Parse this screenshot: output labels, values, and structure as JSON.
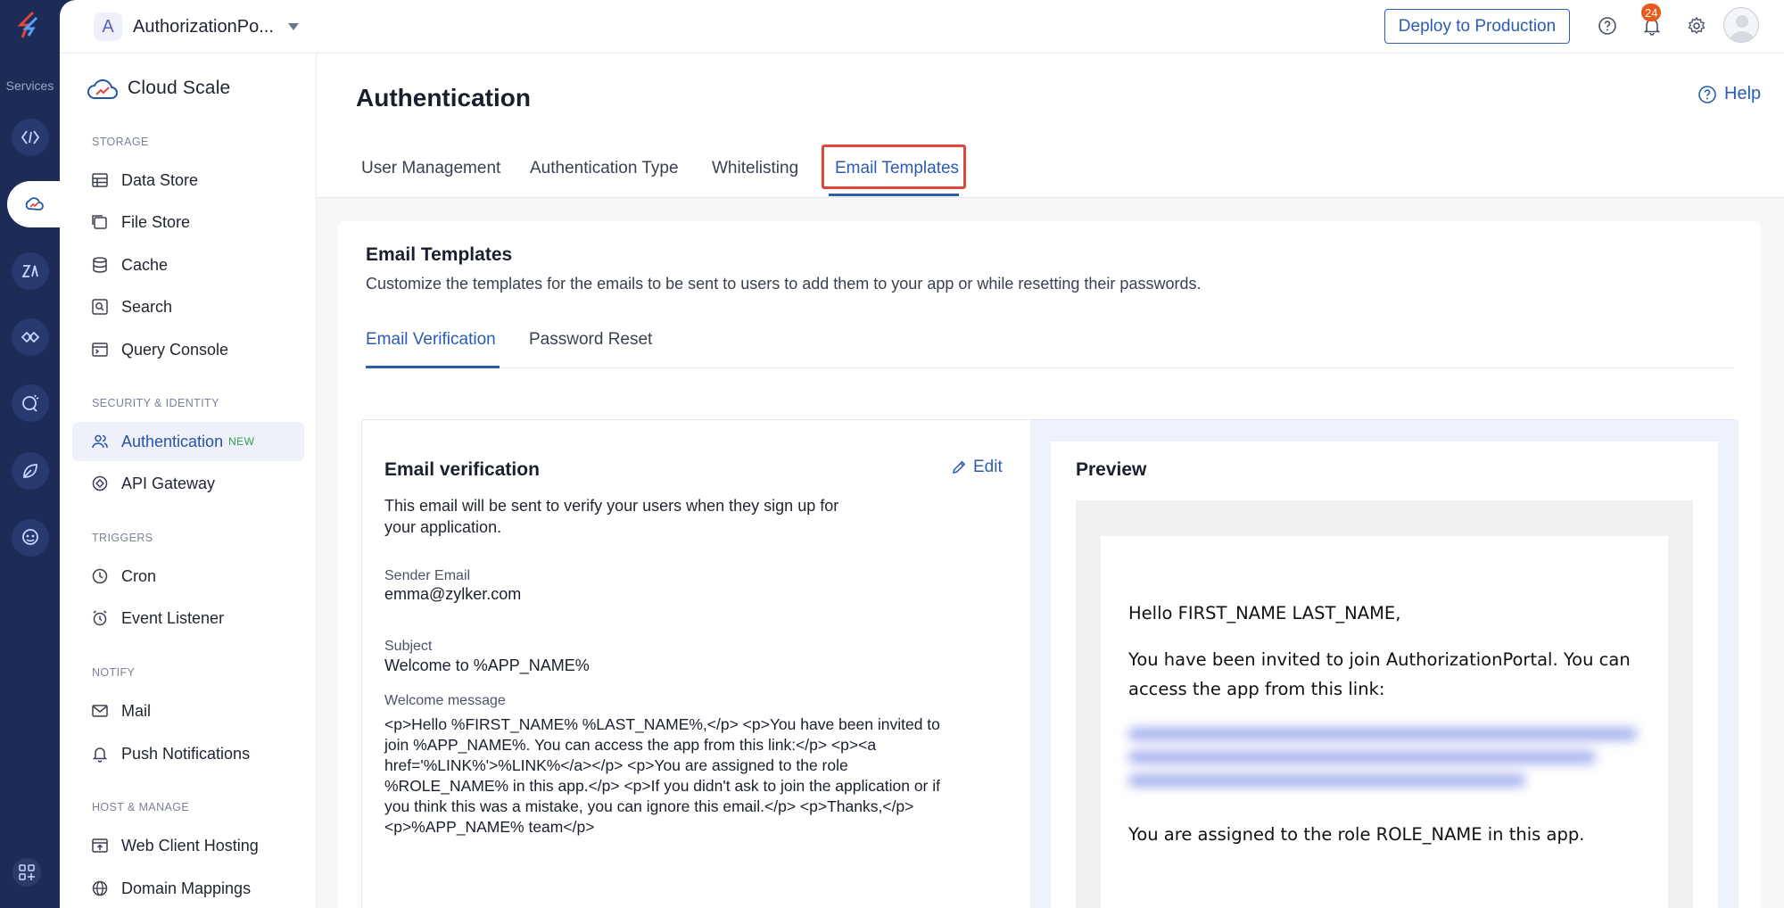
{
  "rail": {
    "services_label": "Services"
  },
  "topbar": {
    "project_initial": "A",
    "project_name": "AuthorizationPo...",
    "deploy_label": "Deploy to Production",
    "notification_count": "24"
  },
  "sidebar": {
    "brand": "Cloud Scale",
    "sections": {
      "storage": "STORAGE",
      "security": "SECURITY & IDENTITY",
      "triggers": "TRIGGERS",
      "notify": "NOTIFY",
      "host": "HOST & MANAGE"
    },
    "items": {
      "data_store": "Data Store",
      "file_store": "File Store",
      "cache": "Cache",
      "search": "Search",
      "query_console": "Query Console",
      "authentication": "Authentication",
      "authentication_badge": "NEW",
      "api_gateway": "API Gateway",
      "cron": "Cron",
      "event_listener": "Event Listener",
      "mail": "Mail",
      "push_notifications": "Push Notifications",
      "web_client_hosting": "Web Client Hosting",
      "domain_mappings": "Domain Mappings"
    }
  },
  "main": {
    "title": "Authentication",
    "help_label": "Help",
    "tabs": {
      "user_management": "User Management",
      "authentication_type": "Authentication Type",
      "whitelisting": "Whitelisting",
      "email_templates": "Email Templates"
    },
    "card": {
      "title": "Email Templates",
      "description": "Customize the templates for the emails to be sent to users to add them to your app or while resetting their passwords.",
      "subtabs": {
        "email_verification": "Email Verification",
        "password_reset": "Password Reset"
      },
      "verification": {
        "title": "Email verification",
        "edit_label": "Edit",
        "description": "This email will be sent to verify your users when they sign up for your application.",
        "sender_label": "Sender Email",
        "sender_value": "emma@zylker.com",
        "subject_label": "Subject",
        "subject_value": "Welcome to %APP_NAME%",
        "message_label": "Welcome message",
        "message_value": "<p>Hello %FIRST_NAME% %LAST_NAME%,</p> <p>You have been invited to join %APP_NAME%. You can access the app from this link:</p> <p><a href='%LINK%'>%LINK%</a></p> <p>You are assigned to the role %ROLE_NAME% in this app.</p> <p>If you didn't ask to join the application or if you think this was a mistake, you can ignore this email.</p> <p>Thanks,</p> <p>%APP_NAME% team</p>"
      },
      "preview": {
        "title": "Preview",
        "greeting": "Hello FIRST_NAME LAST_NAME,",
        "invite": "You have been invited to join AuthorizationPortal. You can access the app from this link:",
        "role": "You are assigned to the role ROLE_NAME in this app."
      }
    }
  },
  "colors": {
    "accent": "#2a5cb0",
    "rail": "#1d2b57",
    "highlight": "#e0473c",
    "notification": "#e8591a",
    "new_badge": "#2e9d4f"
  }
}
